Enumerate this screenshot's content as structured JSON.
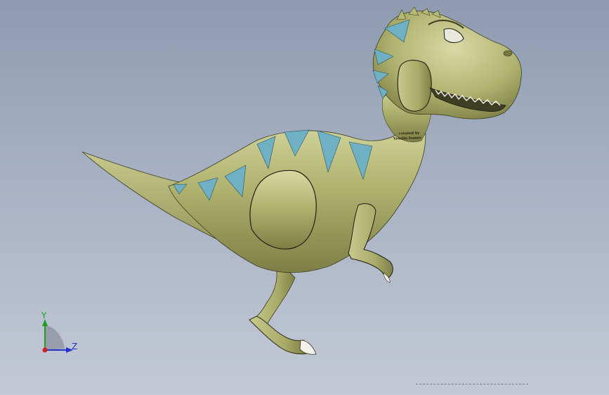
{
  "viewport": {
    "background_top": "#8e9bb0",
    "background_bottom": "#c3c9d6"
  },
  "model": {
    "body_color": "#b4b674",
    "spike_color": "#6fb0c4",
    "outline_color": "#1e1f12",
    "engraving_line1": "created by",
    "engraving_line2": "Veselin Ivanov"
  },
  "triad": {
    "y_label": "Y",
    "z_label": "Z",
    "y_color": "#1ea01e",
    "z_color": "#2233cc",
    "x_color": "#d42020"
  }
}
